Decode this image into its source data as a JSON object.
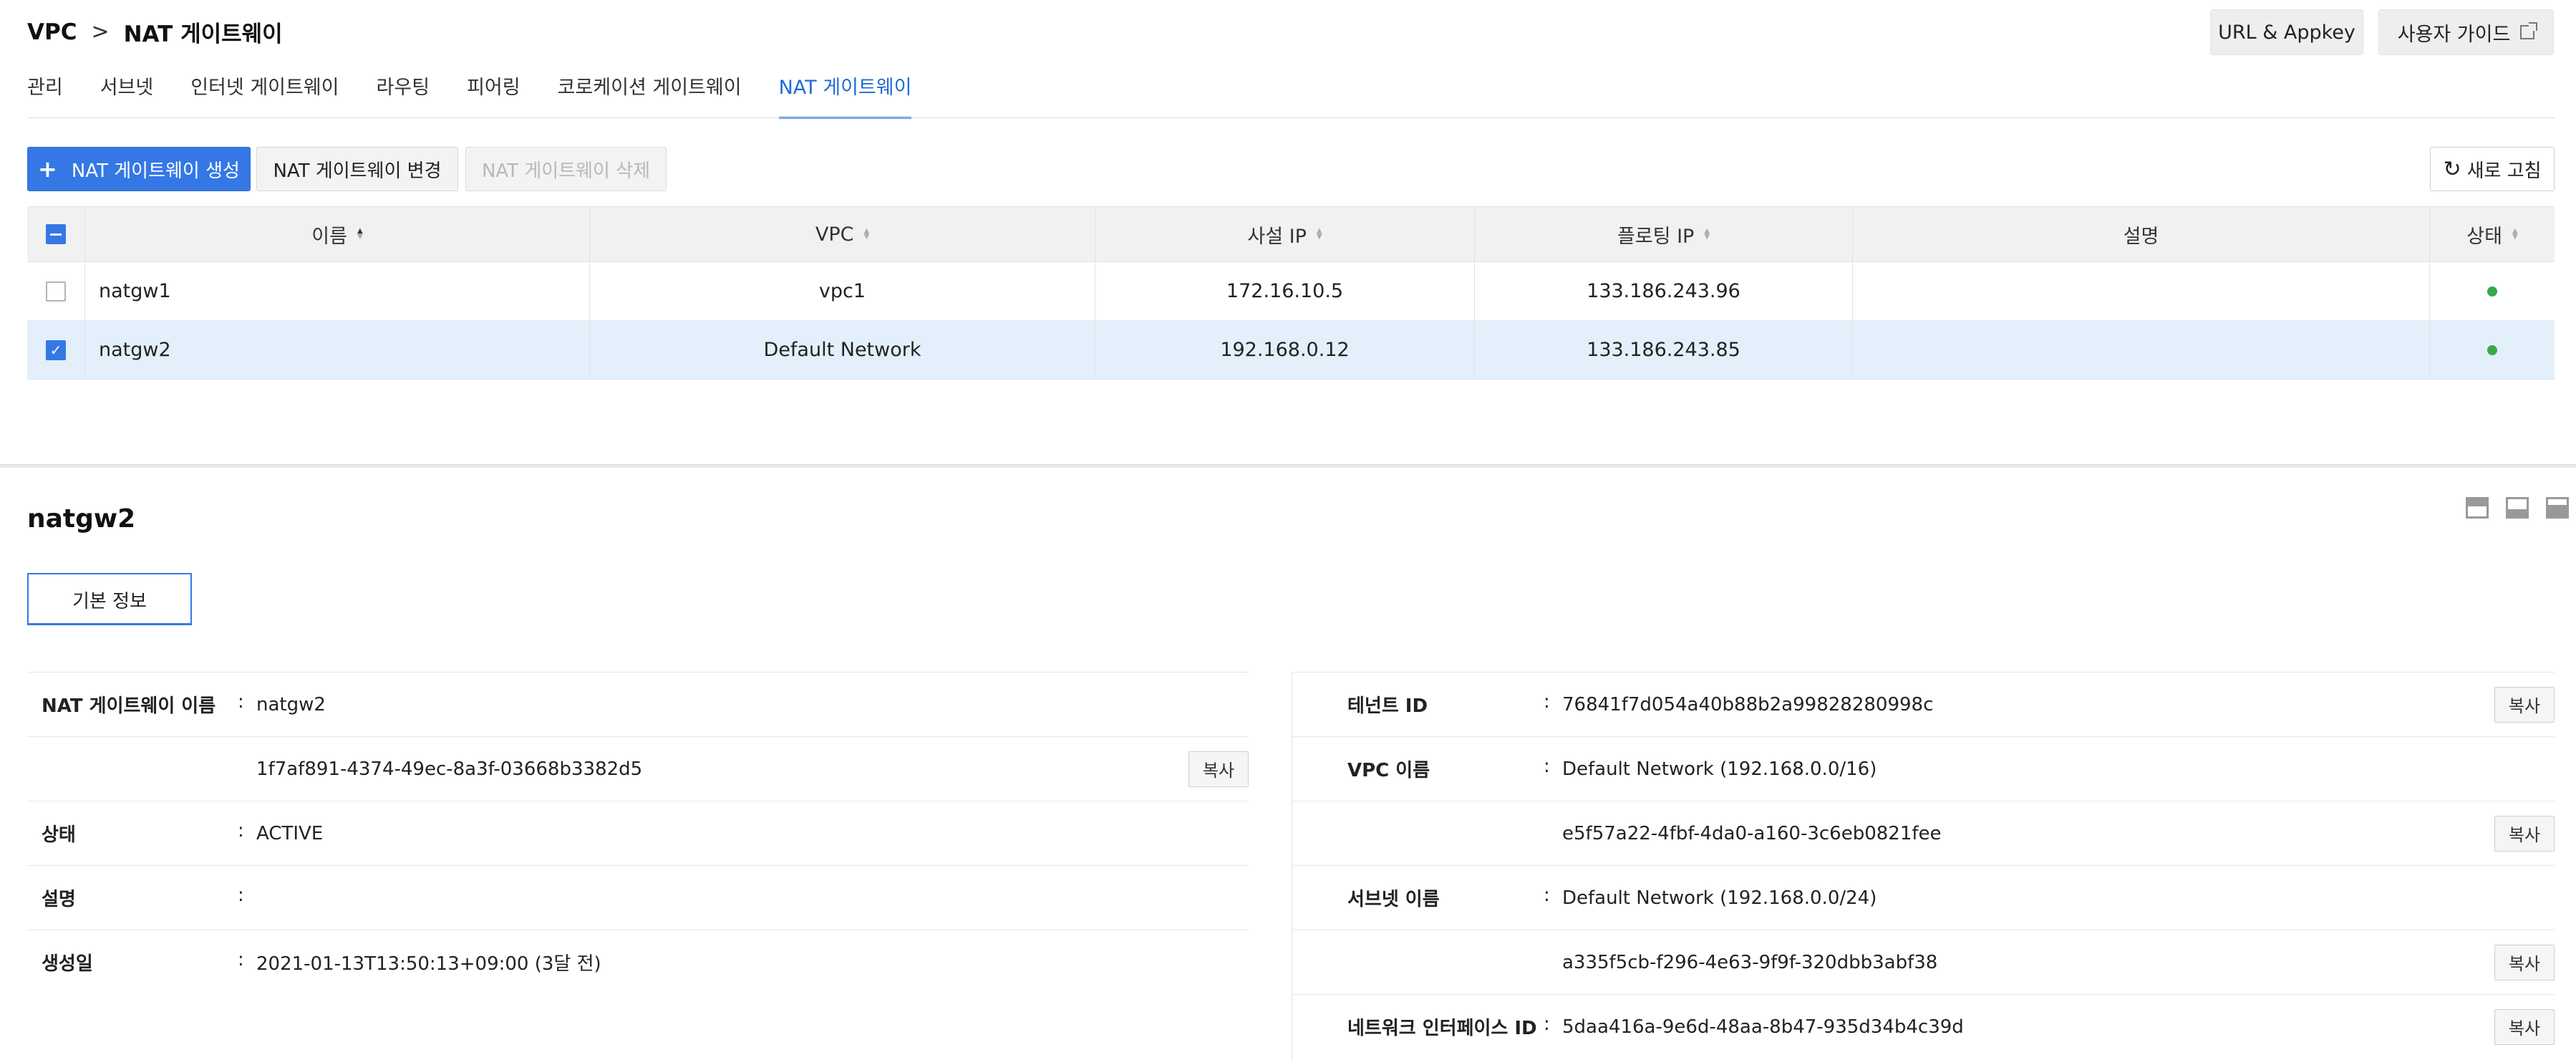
{
  "header": {
    "breadcrumb_root": "VPC",
    "breadcrumb_sep": ">",
    "breadcrumb_current": "NAT 게이트웨이",
    "url_appkey": "URL & Appkey",
    "user_guide": "사용자 가이드"
  },
  "tabs": [
    {
      "label": "관리"
    },
    {
      "label": "서브넷"
    },
    {
      "label": "인터넷 게이트웨이"
    },
    {
      "label": "라우팅"
    },
    {
      "label": "피어링"
    },
    {
      "label": "코로케이션 게이트웨이"
    },
    {
      "label": "NAT 게이트웨이"
    }
  ],
  "actions": {
    "create": "NAT 게이트웨이 생성",
    "create_icon": "+",
    "modify": "NAT 게이트웨이 변경",
    "delete": "NAT 게이트웨이 삭제",
    "refresh": "새로 고침",
    "refresh_icon": "↻"
  },
  "table": {
    "columns": {
      "name": "이름",
      "vpc": "VPC",
      "private_ip": "사설 IP",
      "floating_ip": "플로팅 IP",
      "description": "설명",
      "state": "상태"
    },
    "rows": [
      {
        "name": "natgw1",
        "vpc": "vpc1",
        "private_ip": "172.16.10.5",
        "floating_ip": "133.186.243.96",
        "description": "",
        "checked": false,
        "state_color": "#3aa84a"
      },
      {
        "name": "natgw2",
        "vpc": "Default Network",
        "private_ip": "192.168.0.12",
        "floating_ip": "133.186.243.85",
        "description": "",
        "checked": true,
        "state_color": "#3aa84a"
      }
    ]
  },
  "detail": {
    "title": "natgw2",
    "tab": "기본 정보",
    "colon": ":",
    "copy_label": "복사",
    "left": {
      "nat_name_label": "NAT 게이트웨이 이름",
      "nat_name": "natgw2",
      "nat_id": "1f7af891-4374-49ec-8a3f-03668b3382d5",
      "state_label": "상태",
      "state": "ACTIVE",
      "description_label": "설명",
      "description": "",
      "created_label": "생성일",
      "created": "2021-01-13T13:50:13+09:00 (3달 전)"
    },
    "right": {
      "tenant_label": "테넌트 ID",
      "tenant": "76841f7d054a40b88b2a99828280998c",
      "vpc_label": "VPC 이름",
      "vpc_name": "Default Network (192.168.0.0/16)",
      "vpc_id": "e5f57a22-4fbf-4da0-a160-3c6eb0821fee",
      "subnet_label": "서브넷 이름",
      "subnet_name": "Default Network (192.168.0.0/24)",
      "subnet_id": "a335f5cb-f296-4e63-9f9f-320dbb3abf38",
      "nic_label": "네트워크 인터페이스 ID",
      "nic": "5daa416a-9e6d-48aa-8b47-935d34b4c39d"
    }
  },
  "colors": {
    "accent": "#3578e5",
    "selected_row": "#e3f0fc",
    "active_status": "#3aa84a"
  }
}
